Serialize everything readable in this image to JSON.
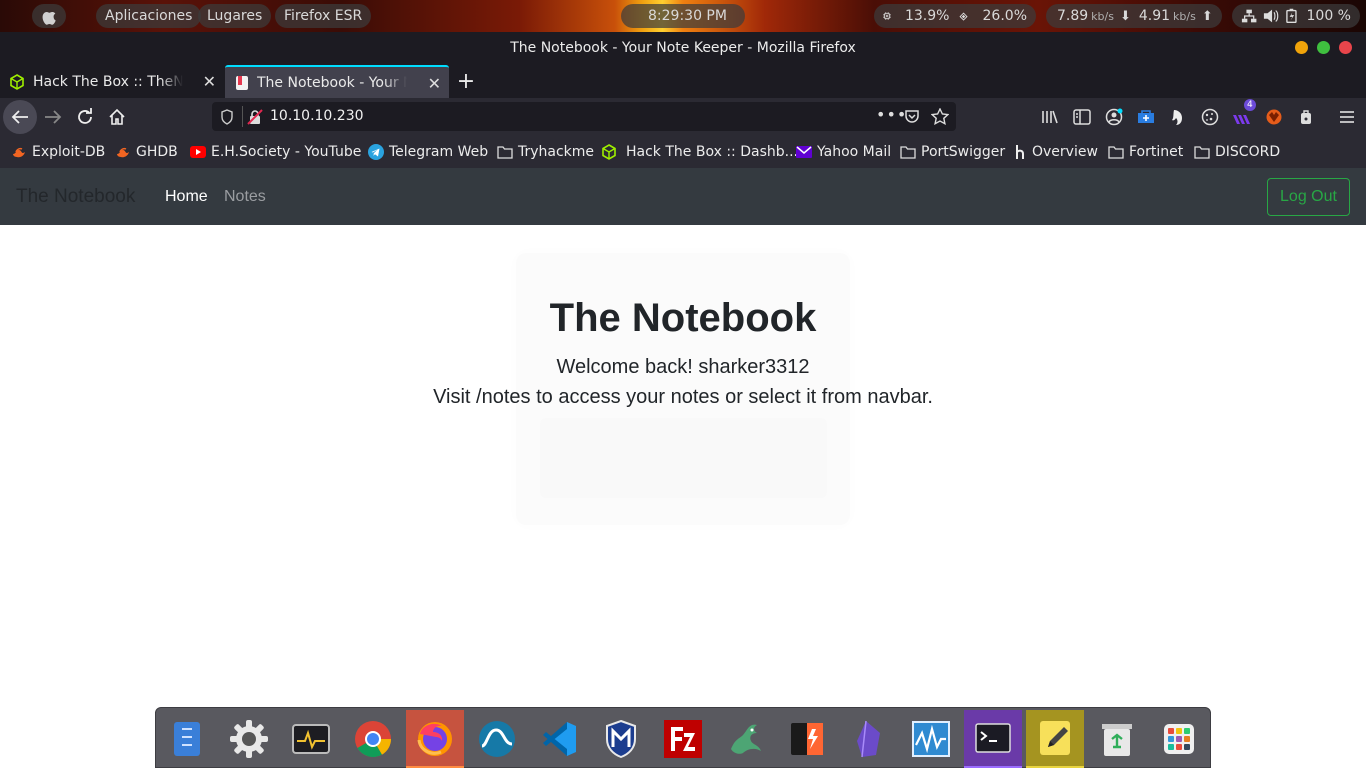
{
  "system_panel": {
    "menu_apps": "Aplicaciones",
    "menu_places": "Lugares",
    "active_app": "Firefox ESR",
    "clock": "8:29:30 PM",
    "cpu": "13.9%",
    "memory": "26.0%",
    "net_down_value": "7.89",
    "net_down_unit": "kb/s",
    "net_up_value": "4.91",
    "net_up_unit": "kb/s",
    "battery": "100 %"
  },
  "window": {
    "title": "The Notebook - Your Note Keeper - Mozilla Firefox"
  },
  "tabs": [
    {
      "label": "Hack The Box :: TheNotebook"
    },
    {
      "label": "The Notebook - Your Note Keeper"
    }
  ],
  "urlbar": {
    "url": "10.10.10.230"
  },
  "toolbar": {
    "extension_badge": "4"
  },
  "bookmarks": [
    {
      "label": "Exploit-DB",
      "icon": "exploitdb-icon"
    },
    {
      "label": "GHDB",
      "icon": "exploitdb-icon"
    },
    {
      "label": "E.H.Society - YouTube",
      "icon": "youtube-icon"
    },
    {
      "label": "Telegram Web",
      "icon": "telegram-icon"
    },
    {
      "label": "Tryhackme",
      "icon": "folder-icon"
    },
    {
      "label": "Hack The Box :: Dashb...",
      "icon": "htb-icon"
    },
    {
      "label": "Yahoo Mail",
      "icon": "yahoo-icon"
    },
    {
      "label": "PortSwigger",
      "icon": "folder-icon"
    },
    {
      "label": "Overview",
      "icon": "hackerone-icon"
    },
    {
      "label": "Fortinet",
      "icon": "folder-icon"
    },
    {
      "label": "DISCORD",
      "icon": "folder-icon"
    }
  ],
  "site": {
    "brand": "The Notebook",
    "nav_home": "Home",
    "nav_notes": "Notes",
    "logout": "Log Out",
    "heading": "The Notebook",
    "welcome": "Welcome back! sharker3312",
    "instructions": "Visit /notes to access your notes or select it from navbar."
  },
  "dock": [
    "files-icon",
    "settings-icon",
    "system-monitor-icon",
    "chrome-icon",
    "firefox-icon",
    "wireshark-icon",
    "vscode-icon",
    "metasploit-icon",
    "filezilla-icon",
    "dragon-icon",
    "burpsuite-icon",
    "obsidian-icon",
    "network-monitor-icon",
    "terminal-icon",
    "notes-icon",
    "trash-icon",
    "app-grid-icon"
  ],
  "colors": {
    "accent_tab": "#00ddff",
    "site_navbar": "#343a40",
    "logout_green": "#28a745"
  }
}
